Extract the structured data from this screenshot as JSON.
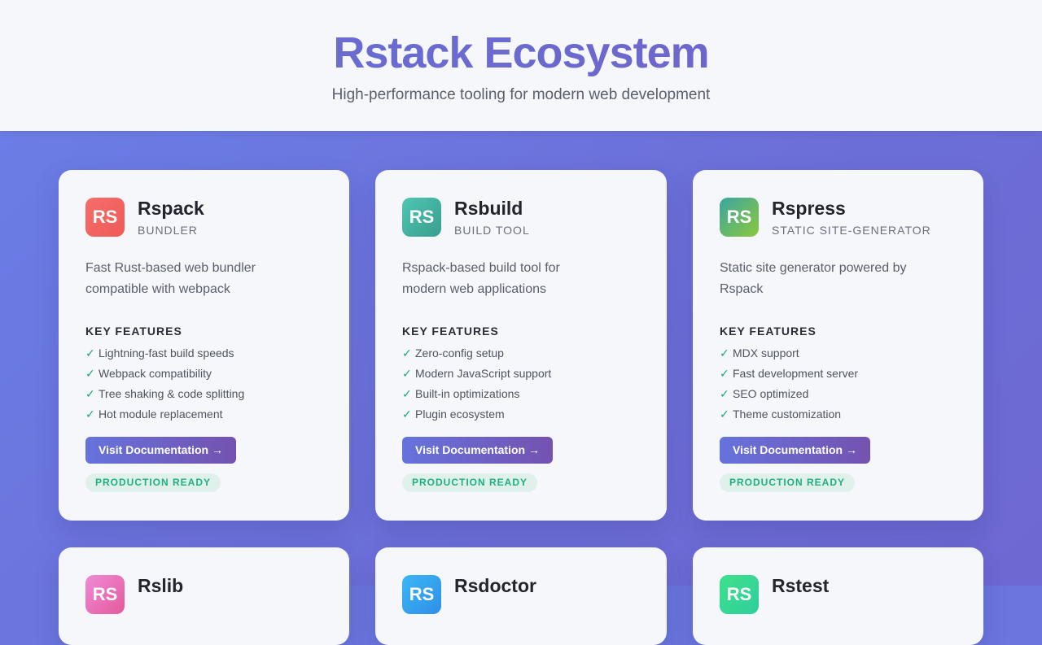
{
  "header": {
    "title": "Rstack Ecosystem",
    "subtitle": "High-performance tooling for modern web development"
  },
  "cards": [
    {
      "logo": "RS",
      "logo_colors": [
        "#f56d6d",
        "#ef5a55"
      ],
      "name": "Rspack",
      "category": "BUNDLER",
      "description": "Fast Rust-based web bundler compatible with webpack",
      "features_title": "KEY FEATURES",
      "features": [
        "Lightning-fast build speeds",
        "Webpack compatibility",
        "Tree shaking & code splitting",
        "Hot module replacement"
      ],
      "button": "Visit Documentation →",
      "badge": "PRODUCTION READY"
    },
    {
      "logo": "RS",
      "logo_colors": [
        "#4ec7b4",
        "#3a9d8d"
      ],
      "name": "Rsbuild",
      "category": "BUILD TOOL",
      "description": "Rspack-based build tool for modern web applications",
      "features_title": "KEY FEATURES",
      "features": [
        "Zero-config setup",
        "Modern JavaScript support",
        "Built-in optimizations",
        "Plugin ecosystem"
      ],
      "button": "Visit Documentation →",
      "badge": "PRODUCTION READY"
    },
    {
      "logo": "RS",
      "logo_colors": [
        "#3aa6a0",
        "#8cc83c"
      ],
      "name": "Rspress",
      "category": "STATIC SITE-GENERATOR",
      "description": "Static site generator powered by Rspack",
      "features_title": "KEY FEATURES",
      "features": [
        "MDX support",
        "Fast development server",
        "SEO optimized",
        "Theme customization"
      ],
      "button": "Visit Documentation →",
      "badge": "PRODUCTION READY"
    },
    {
      "logo": "RS",
      "logo_colors": [
        "#f08ad8",
        "#e45a9a"
      ],
      "name": "Rslib",
      "category": "",
      "description": "",
      "features_title": "",
      "features": [],
      "button": "",
      "badge": ""
    },
    {
      "logo": "RS",
      "logo_colors": [
        "#3bb6f5",
        "#2f8fe8"
      ],
      "name": "Rsdoctor",
      "category": "",
      "description": "",
      "features_title": "",
      "features": [],
      "button": "",
      "badge": ""
    },
    {
      "logo": "RS",
      "logo_colors": [
        "#3ee08b",
        "#2fcf9c"
      ],
      "name": "Rstest",
      "category": "",
      "description": "",
      "features_title": "",
      "features": [],
      "button": "",
      "badge": ""
    }
  ]
}
